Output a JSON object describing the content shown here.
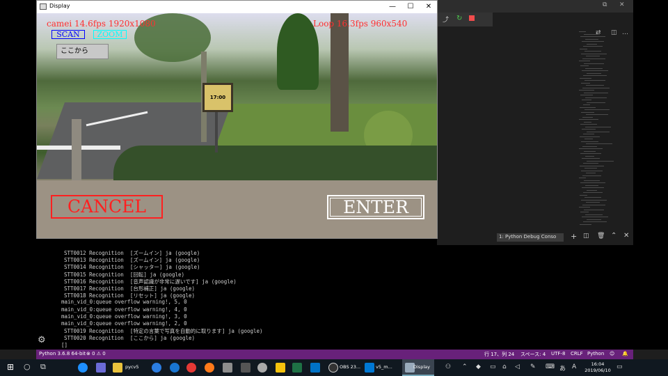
{
  "display_window": {
    "title": "Display",
    "minimize": "—",
    "maximize": "☐",
    "close": "✕",
    "overlay": {
      "camera_info_left": "camei 14.6fps 1920x1080",
      "camera_info_right": "Loop 16.3fps  960x540",
      "scan_button": "SCAN",
      "zoom_button": "ZOOM",
      "kokokara_button": "ここから",
      "cancel_button": "CANCEL",
      "enter_button": "ENTER"
    },
    "sign_text": "17:00"
  },
  "terminal": {
    "panel_selector": "1: Python Debug Conso",
    "lines": [
      "STT0012 Recognition  [ズームイン] ja (google)",
      "STT0013 Recognition  [ズームイン] ja (google)",
      "STT0014 Recognition  [シャッター] ja (google)",
      "STT0015 Recognition  [回転] ja (google)",
      "STT0016 Recognition  [音声認識が非常に遅いです] ja (google)",
      "STT0017 Recognition  [台形補正] ja (google)",
      "STT0018 Recognition  [リセット] ja (google)",
      "main_vid_0:queue overflow warning!, 5, 0",
      "main_vid_0:queue overflow warning!, 4, 0",
      "main_vid_0:queue overflow warning!, 3, 0",
      "main_vid_0:queue overflow warning!, 2, 0",
      "STT0019 Recognition  [特定の言葉で写真を自動的に取ります] ja (google)",
      "STT0020 Recognition  [ここから] ja (google)",
      "[]"
    ]
  },
  "statusbar": {
    "python": "Python 3.6.8 64-bit",
    "problems": "⊗ 0 ⚠ 0",
    "position": "行 17、列 24",
    "spaces": "スペース: 4",
    "encoding": "UTF-8",
    "eol": "CRLF",
    "language": "Python"
  },
  "taskbar": {
    "items": [
      "pycv5",
      "OBS 23...",
      "v5_m...",
      "Display"
    ],
    "time": "16:04",
    "date": "2019/06/10"
  },
  "colors": {
    "statusbar": "#68217a",
    "cancel": "#ff2020",
    "enter": "#ffffff",
    "zoom": "#00ffff",
    "scan": "#0000ff"
  }
}
